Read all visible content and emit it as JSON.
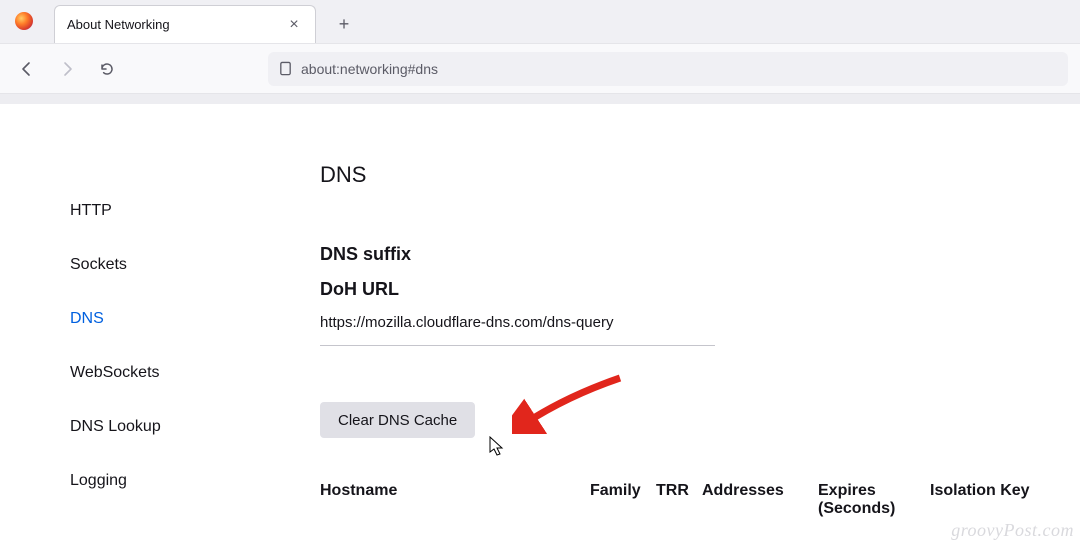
{
  "tab": {
    "title": "About Networking"
  },
  "url": "about:networking#dns",
  "sidebar": {
    "items": [
      {
        "label": "HTTP"
      },
      {
        "label": "Sockets"
      },
      {
        "label": "DNS"
      },
      {
        "label": "WebSockets"
      },
      {
        "label": "DNS Lookup"
      },
      {
        "label": "Logging"
      }
    ],
    "active_index": 2
  },
  "main": {
    "title": "DNS",
    "dns_suffix_label": "DNS suffix",
    "doh_url_label": "DoH URL",
    "doh_url_value": "https://mozilla.cloudflare-dns.com/dns-query",
    "clear_button": "Clear DNS Cache",
    "columns": {
      "hostname": "Hostname",
      "family": "Family",
      "trr": "TRR",
      "addresses": "Addresses",
      "expires": "Expires (Seconds)",
      "isolation": "Isolation Key"
    }
  },
  "watermark": "groovyPost.com"
}
